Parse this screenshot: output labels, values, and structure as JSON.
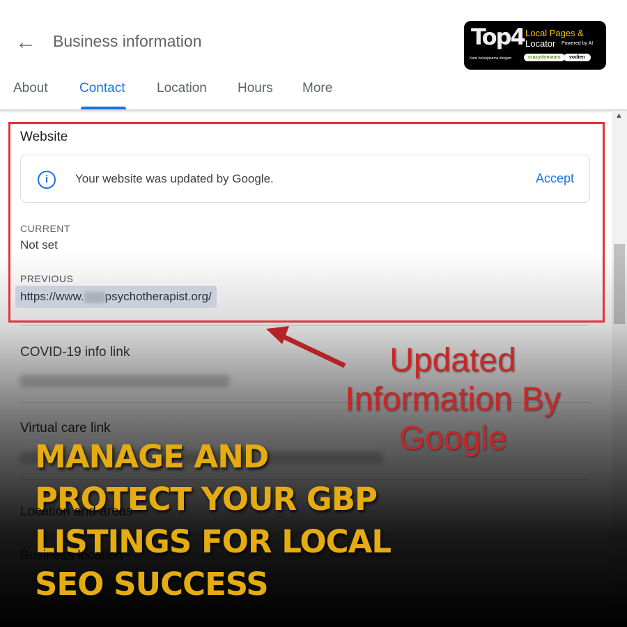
{
  "header": {
    "title": "Business information",
    "back_icon": "arrow-left-icon"
  },
  "tabs": [
    {
      "label": "About"
    },
    {
      "label": "Contact",
      "active": true
    },
    {
      "label": "Location"
    },
    {
      "label": "Hours"
    },
    {
      "label": "More"
    }
  ],
  "website": {
    "heading": "Website",
    "notice": "Your website was updated by Google.",
    "accept_label": "Accept",
    "current_label": "CURRENT",
    "current_value": "Not set",
    "previous_label": "PREVIOUS",
    "previous_value_prefix": "https://www.",
    "previous_value_suffix": "psychotherapist.org/"
  },
  "sections": [
    {
      "heading": "COVID-19 info link"
    },
    {
      "heading": "Virtual care link"
    },
    {
      "heading": "Location and areas"
    },
    {
      "heading": "Business location"
    }
  ],
  "annotation": {
    "lines": [
      "Updated",
      "Information By",
      "Google"
    ],
    "color": "#c62828"
  },
  "headline": {
    "lines": [
      "MANAGE AND",
      "PROTECT YOUR GBP",
      "LISTINGS FOR LOCAL",
      "SEO SUCCESS"
    ],
    "color": "#e5ac12"
  },
  "logo": {
    "brand": "Top4",
    "line1": "Local Pages &",
    "line2": "Locator",
    "powered": "Powered by AI",
    "partner_text": "Kami bekerjasama dengan:",
    "partner1": "crazydomains",
    "partner2": "vodien"
  }
}
